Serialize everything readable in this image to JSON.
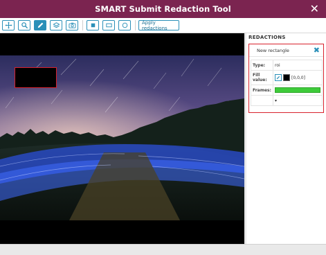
{
  "window": {
    "title": "SMART Submit Redaction Tool",
    "close_glyph": "✕"
  },
  "toolbar": {
    "tools": [
      {
        "name": "move-tool",
        "icon": "move-icon",
        "active": false
      },
      {
        "name": "zoom-tool",
        "icon": "magnifier-icon",
        "active": false
      },
      {
        "name": "draw-tool",
        "icon": "pencil-icon",
        "active": true
      },
      {
        "name": "layers-tool",
        "icon": "layers-icon",
        "active": false
      },
      {
        "name": "snapshot-tool",
        "icon": "camera-icon",
        "active": false
      },
      {
        "name": "filled-rect-tool",
        "icon": "filled-square-icon",
        "active": false
      },
      {
        "name": "rect-tool",
        "icon": "rectangle-icon",
        "active": false
      },
      {
        "name": "ellipse-tool",
        "icon": "ellipse-icon",
        "active": false
      }
    ],
    "apply_label": "Apply redactions"
  },
  "colors": {
    "title_bar": "#7b2450",
    "accent": "#2a8fb8",
    "redaction_border": "#d8212c",
    "frames_bar": "#3ecb3a"
  },
  "panel": {
    "title": "REDACTIONS",
    "items": [
      {
        "name": "New rectangle",
        "close_glyph": "✖",
        "type_label": "Type:",
        "type_value": "roi",
        "fill_label": "Fill value:",
        "fill_value": "[0,0,0]",
        "frames_label": "Frames:",
        "frames_fraction": 1.0,
        "expand_glyph": "▾"
      }
    ]
  }
}
